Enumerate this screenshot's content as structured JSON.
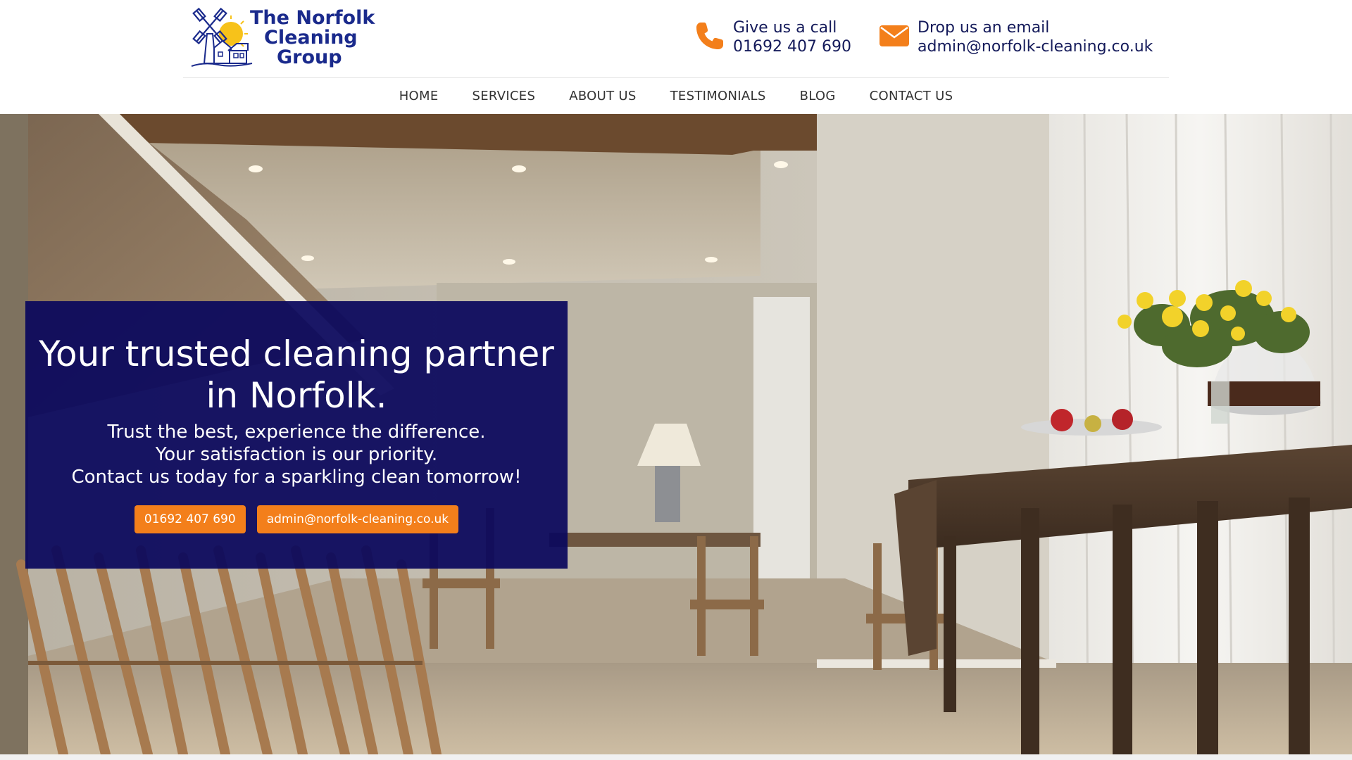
{
  "brand": {
    "line1": "The Norfolk",
    "line2": "Cleaning",
    "line3": "Group"
  },
  "contact": {
    "call_label": "Give us a call",
    "call_value": "01692 407 690",
    "email_label": "Drop us an email",
    "email_value": "admin@norfolk-cleaning.co.uk"
  },
  "nav": {
    "items": [
      {
        "label": "HOME"
      },
      {
        "label": "SERVICES"
      },
      {
        "label": "ABOUT US"
      },
      {
        "label": "TESTIMONIALS"
      },
      {
        "label": "BLOG"
      },
      {
        "label": "CONTACT US"
      }
    ]
  },
  "hero": {
    "title_line1": "Your trusted cleaning partner",
    "title_line2": "in Norfolk.",
    "sub_line1": "Trust the best, experience the difference.",
    "sub_line2": "Your satisfaction is our priority.",
    "sub_line3": "Contact us today for a sparkling clean tomorrow!",
    "phone_button": "01692 407 690",
    "email_button": "admin@norfolk-cleaning.co.uk"
  },
  "colors": {
    "accent": "#f37f1b",
    "brand_blue": "#1a2a8c",
    "hero_card": "#0a085c"
  }
}
